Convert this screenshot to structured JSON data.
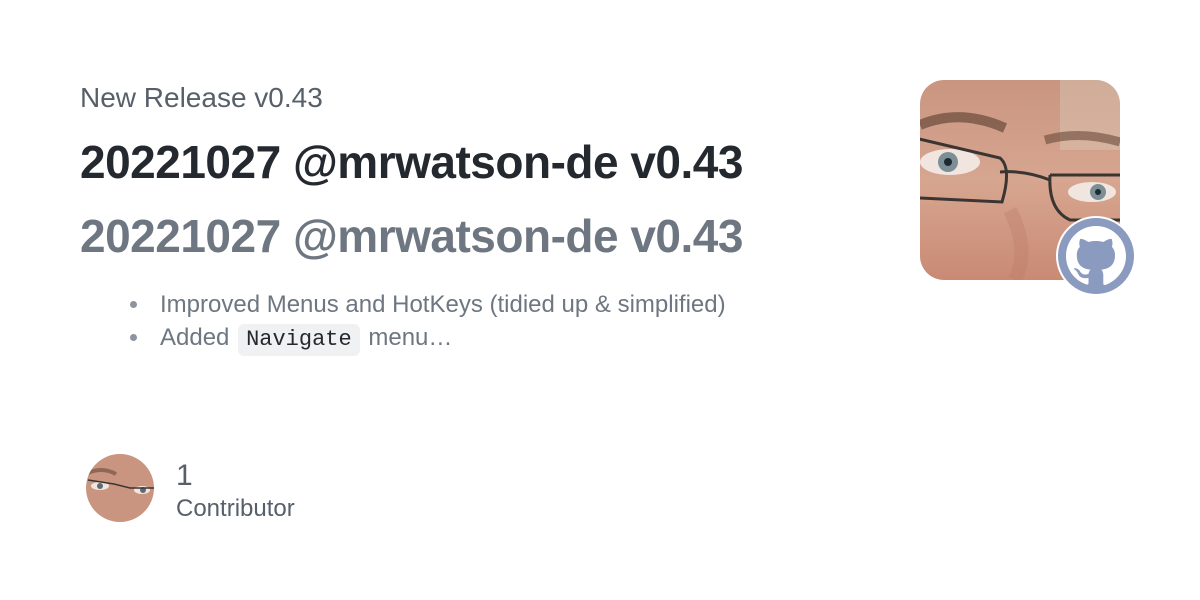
{
  "release": {
    "eyebrow": "New Release v0.43",
    "title": "20221027 @mrwatson-de v0.43",
    "subtitle": "20221027 @mrwatson-de v0.43"
  },
  "notes": [
    {
      "text": "Improved Menus and HotKeys (tidied up & simplified)"
    },
    {
      "before": "Added ",
      "code": "Navigate",
      "after": " menu…"
    }
  ],
  "contributors": {
    "count": "1",
    "label": "Contributor"
  },
  "icons": {
    "brand": "github-icon",
    "owner_avatar": "avatar",
    "contributor_avatar": "avatar"
  },
  "colors": {
    "title": "#24292f",
    "subtitle": "#6e7781",
    "muted": "#57606a",
    "github_badge": "#8b9bbf"
  }
}
